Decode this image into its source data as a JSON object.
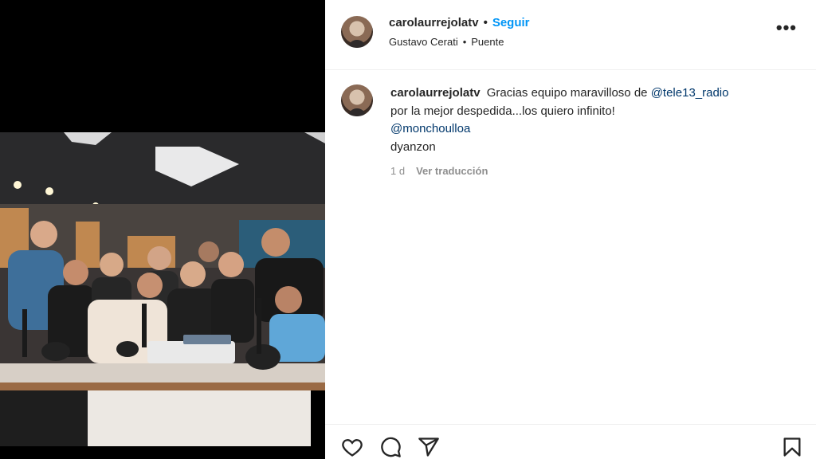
{
  "post": {
    "username": "carolaurrejolatv",
    "separator": "•",
    "follow_label": "Seguir",
    "audio_artist": "Gustavo Cerati",
    "audio_separator": "•",
    "audio_track": "Puente",
    "more_label": "•••"
  },
  "caption": {
    "username": "carolaurrejolatv",
    "text_1": "Gracias equipo maravilloso de",
    "mention_1": "@tele13_radio",
    "text_2": "por la mejor despedida...los quiero infinito!",
    "mention_2": "@monchoulloa",
    "text_3": "dyanzon",
    "time": "1 d",
    "translate_label": "Ver traducción"
  },
  "icons": {
    "like": "heart-icon",
    "comment": "comment-icon",
    "share": "share-icon",
    "save": "bookmark-icon"
  },
  "colors": {
    "link": "#0095f6",
    "mention": "#00376b",
    "muted": "#8e8e8e"
  }
}
